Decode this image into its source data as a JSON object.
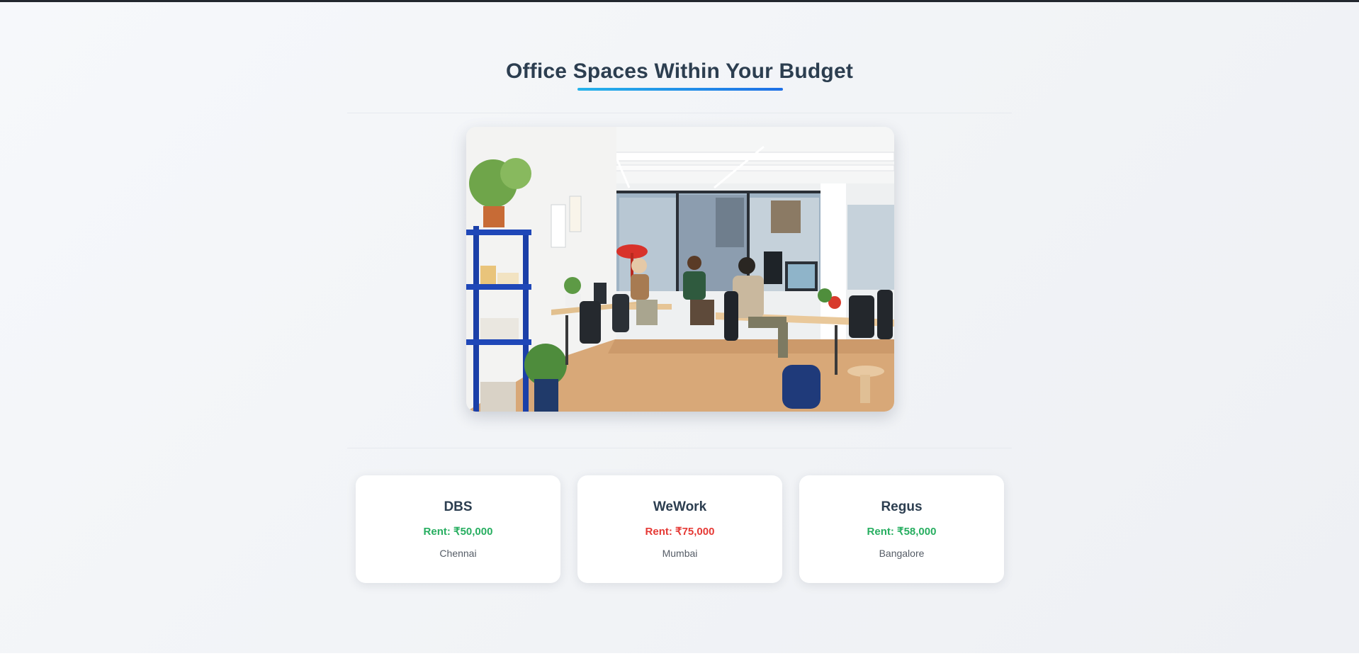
{
  "page": {
    "title": "Office Spaces Within Your Budget"
  },
  "colors": {
    "title": "#2c3e50",
    "underline_start": "#26b3ea",
    "underline_end": "#1e6fe6",
    "within_budget": "#27ae60",
    "over_budget": "#e53935"
  },
  "hero_image": {
    "description_icon": "office-photo-icon"
  },
  "offices": [
    {
      "name": "DBS",
      "rent": "Rent: ₹50,000",
      "location": "Chennai",
      "status": "within_budget"
    },
    {
      "name": "WeWork",
      "rent": "Rent: ₹75,000",
      "location": "Mumbai",
      "status": "over_budget"
    },
    {
      "name": "Regus",
      "rent": "Rent: ₹58,000",
      "location": "Bangalore",
      "status": "within_budget"
    }
  ]
}
